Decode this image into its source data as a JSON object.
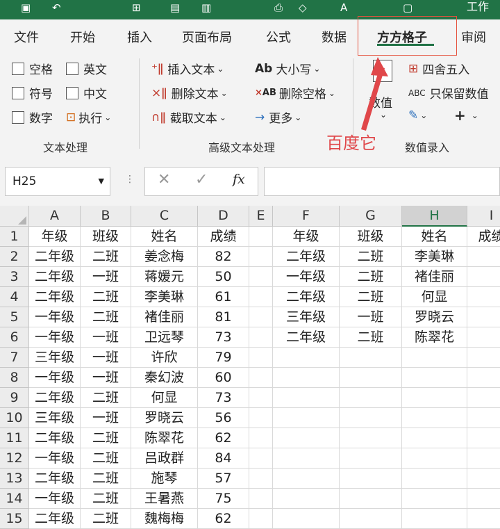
{
  "title_text": "工作",
  "tabs": [
    "文件",
    "开始",
    "插入",
    "页面布局",
    "公式",
    "数据",
    "方方格子",
    "审阅"
  ],
  "active_tab": "方方格子",
  "ribbon": {
    "checks": [
      "空格",
      "英文",
      "符号",
      "中文",
      "数字"
    ],
    "exec_label": "执行",
    "text_group_label": "文本处理",
    "insert_text": "插入文本",
    "delete_text": "删除文本",
    "extract_text": "截取文本",
    "case_label": "大小写",
    "delete_space": "删除空格",
    "more_label": "更多",
    "adv_group_label": "高级文本处理",
    "numeric_label": "数值",
    "round_label": "四舍五入",
    "keep_value": "只保留数值",
    "entry_group_label": "数值录入"
  },
  "annotation_text": "百度它",
  "name_box": "H25",
  "columns": [
    "A",
    "B",
    "C",
    "D",
    "E",
    "F",
    "G",
    "H",
    "I"
  ],
  "selected_column": "H",
  "rows": [
    [
      "年级",
      "班级",
      "姓名",
      "成绩",
      "",
      "年级",
      "班级",
      "姓名",
      "成绩"
    ],
    [
      "二年级",
      "二班",
      "姜念梅",
      "82",
      "",
      "二年级",
      "二班",
      "李美琳",
      ""
    ],
    [
      "二年级",
      "一班",
      "蒋媛元",
      "50",
      "",
      "一年级",
      "二班",
      "褚佳丽",
      ""
    ],
    [
      "二年级",
      "二班",
      "李美琳",
      "61",
      "",
      "二年级",
      "二班",
      "何显",
      ""
    ],
    [
      "一年级",
      "二班",
      "褚佳丽",
      "81",
      "",
      "三年级",
      "一班",
      "罗晓云",
      ""
    ],
    [
      "一年级",
      "一班",
      "卫远琴",
      "73",
      "",
      "二年级",
      "二班",
      "陈翠花",
      ""
    ],
    [
      "三年级",
      "一班",
      "许欣",
      "79",
      "",
      "",
      "",
      "",
      ""
    ],
    [
      "一年级",
      "一班",
      "秦幻波",
      "60",
      "",
      "",
      "",
      "",
      ""
    ],
    [
      "二年级",
      "二班",
      "何显",
      "73",
      "",
      "",
      "",
      "",
      ""
    ],
    [
      "三年级",
      "一班",
      "罗晓云",
      "56",
      "",
      "",
      "",
      "",
      ""
    ],
    [
      "二年级",
      "二班",
      "陈翠花",
      "62",
      "",
      "",
      "",
      "",
      ""
    ],
    [
      "一年级",
      "二班",
      "吕政群",
      "84",
      "",
      "",
      "",
      "",
      ""
    ],
    [
      "二年级",
      "二班",
      "施琴",
      "57",
      "",
      "",
      "",
      "",
      ""
    ],
    [
      "一年级",
      "二班",
      "王暑燕",
      "75",
      "",
      "",
      "",
      "",
      ""
    ],
    [
      "二年级",
      "二班",
      "魏梅梅",
      "62",
      "",
      "",
      "",
      "",
      ""
    ]
  ]
}
